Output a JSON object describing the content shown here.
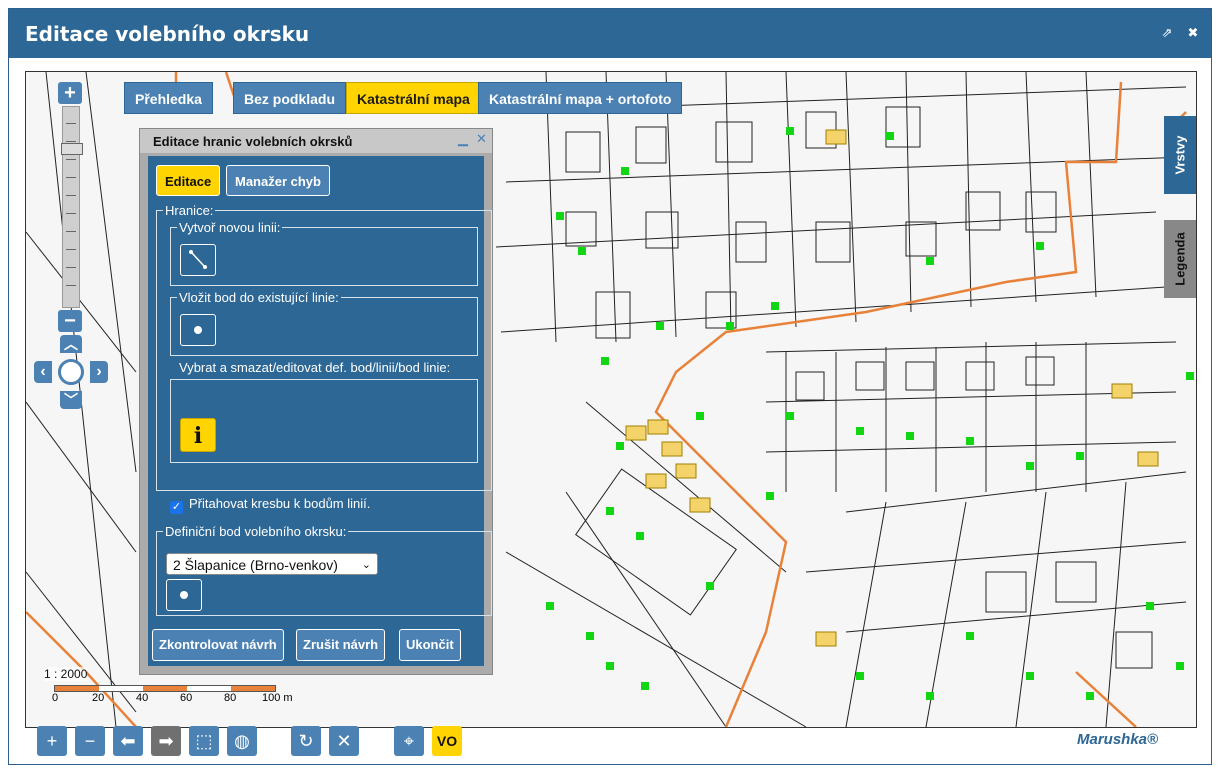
{
  "window": {
    "title": "Editace volebního okrsku",
    "popout_icon": "⇗",
    "close_icon": "✖"
  },
  "layers": [
    {
      "label": "Přehledka",
      "active": false
    },
    {
      "label": "Bez podkladu",
      "active": false
    },
    {
      "label": "Katastrální mapa",
      "active": true
    },
    {
      "label": "Katastrální mapa + ortofoto",
      "active": false
    }
  ],
  "side_tabs": {
    "layers": "Vrstvy",
    "legend": "Legenda"
  },
  "zoom": {
    "plus": "+",
    "minus": "−"
  },
  "scale": {
    "ratio": "1 : 2000",
    "ticks": [
      "0",
      "20",
      "40",
      "60",
      "80",
      "100 m"
    ]
  },
  "panel": {
    "title": "Editace hranic volebních okrsků",
    "tabs": {
      "edit": "Editace",
      "errors": "Manažer chyb"
    },
    "boundaries": {
      "legend": "Hranice:",
      "new_line": "Vytvoř novou linii:",
      "insert_point": "Vložit bod do existující linie:",
      "select_edit": "Vybrat a smazat/editovat def. bod/linii/bod linie:",
      "info_glyph": "i"
    },
    "snap_label": "Přitahovat kresbu k bodům linií.",
    "snap_checked": true,
    "definition_point": {
      "legend": "Definiční bod volebního okrsku:",
      "selected": "2 Šlapanice (Brno-venkov)"
    },
    "actions": {
      "check": "Zkontrolovat návrh",
      "cancel": "Zrušit návrh",
      "finish": "Ukončit"
    }
  },
  "toolbar": {
    "items": [
      {
        "name": "zoom-in-tool",
        "glyph": "+"
      },
      {
        "name": "zoom-out-tool",
        "glyph": "−"
      },
      {
        "name": "back-tool",
        "glyph": "⬅"
      },
      {
        "name": "forward-tool",
        "glyph": "➡"
      },
      {
        "name": "select-area-tool",
        "glyph": "⬚"
      },
      {
        "name": "globe-tool",
        "glyph": "◍"
      },
      {
        "name": "refresh-tool",
        "glyph": "↻"
      },
      {
        "name": "clear-tool",
        "glyph": "✕"
      },
      {
        "name": "locate-tool",
        "glyph": "⌖"
      }
    ],
    "vo_label": "VO"
  },
  "brand": "Marushka®",
  "colors": {
    "primary": "#2d6795",
    "button": "#4b82b3",
    "accent": "#ffd400",
    "boundary": "#e8823a",
    "point": "#12d612"
  }
}
